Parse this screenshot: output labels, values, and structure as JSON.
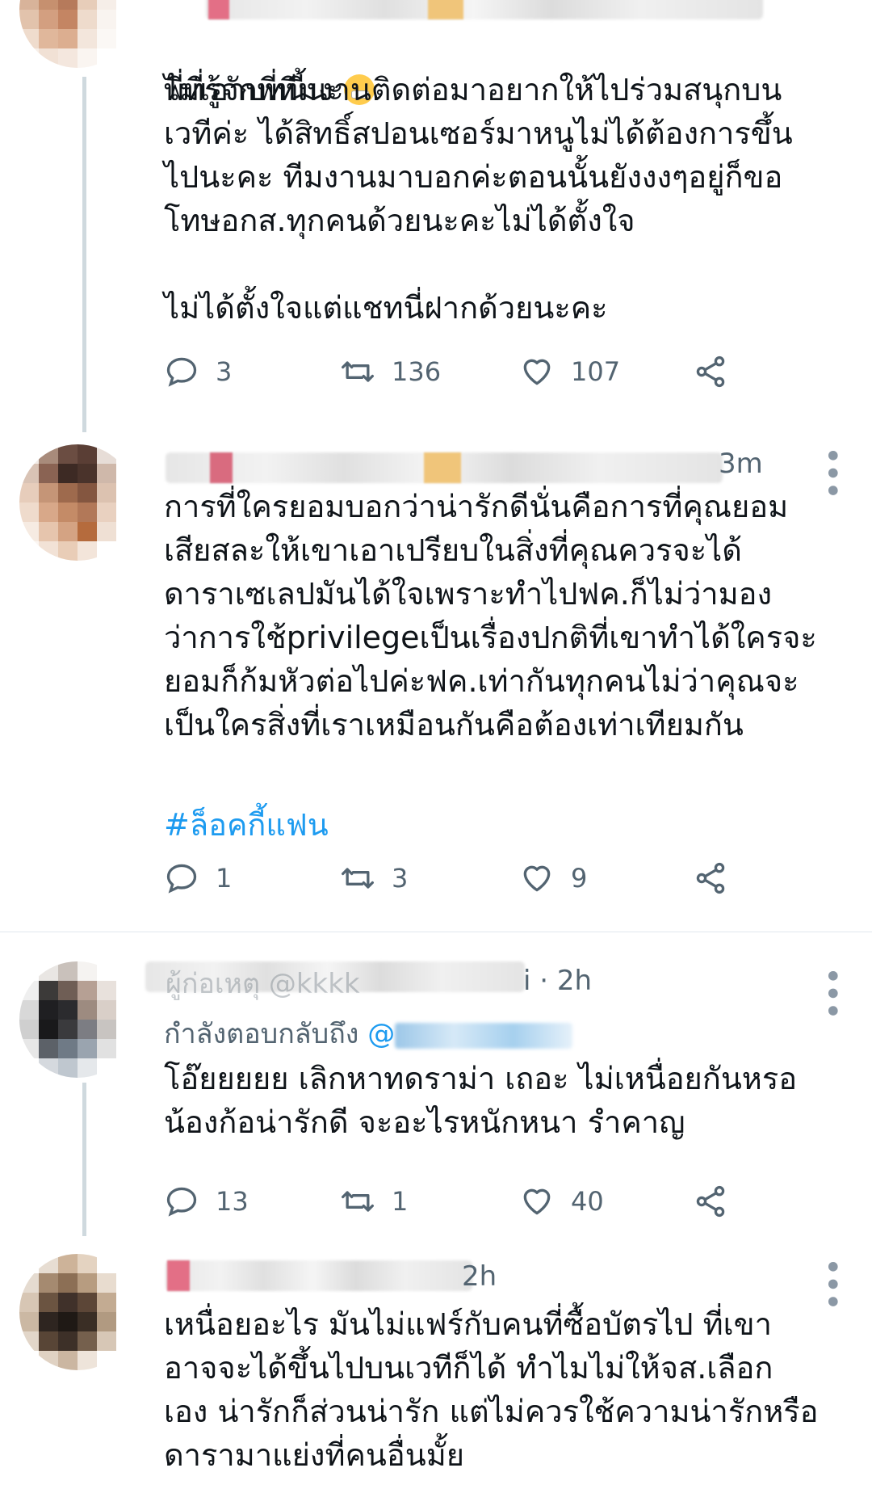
{
  "tweets": [
    {
      "text": "ไม่เอาบทนี้นะ",
      "text2": "พี่ที่รู้จักพี่ทีมงานติดต่อมาอยากให้ไปร่วมสนุกบน\nเวทีค่ะ ได้สิทธิ์สปอนเซอร์มาหนูไม่ได้ต้องการขึ้น\nไปนะคะ ทีมงานมาบอกค่ะตอนนั้นยังงงๆอยู่ก็ขอ\nโทษอกส.ทุกคนด้วยนะคะไม่ได้ตั้งใจ\n\nไม่ได้ตั้งใจแต่แชทนี่ฝากด้วยนะคะ",
      "emoji": "nauseated-face-emoji",
      "replies": "3",
      "retweets": "136",
      "likes": "107"
    },
    {
      "time": "3m",
      "text": "การที่ใครยอมบอกว่าน่ารักดีนั่นคือการที่คุณยอม\nเสียสละให้เขาเอาเปรียบในสิ่งที่คุณควรจะได้\nดาราเซเลปมันได้ใจเพราะทำไปฟค.ก็ไม่ว่ามอง\nว่าการใช้privilegeเป็นเรื่องปกติที่เขาทำได้ใครจะ\nยอมก็ก้มหัวต่อไปค่ะฟค.เท่ากันทุกคนไม่ว่าคุณจะ\nเป็นใครสิ่งที่เราเหมือนกันคือต้องเท่าเทียมกัน",
      "hashtag": "#ล็อคกี้แฟน",
      "replies": "1",
      "retweets": "3",
      "likes": "9"
    },
    {
      "name_partial": "ผู้ก่อเหตุ @kkkk",
      "handle_tail": "i · 2h",
      "replying_to": "กำลังตอบกลับถึง",
      "mention_prefix": "@",
      "mention_mid": "_",
      "text": "โอ๊ยยยยย เลิกหาทดราม่า เถอะ ไม่เหนื่อยกันหรอ\nน้องก้อน่ารักดี จะอะไรหนักหนา รำคาญ",
      "replies": "13",
      "retweets": "1",
      "likes": "40"
    },
    {
      "time": "2h",
      "text": "เหนื่อยอะไร มันไม่แฟร์กับคนที่ซื้อบัตรไป ที่เขา\nอาจจะได้ขึ้นไปบนเวทีก็ได้ ทำไมไม่ให้จส.เลือก\nเอง น่ารักก็ส่วนน่ารัก แต่ไม่ควรใช้ความน่ารักหรือ\nดารามาแย่งที่คนอื่นมั้ย"
    }
  ],
  "colors": {
    "text": "#0f1419",
    "muted": "#536471",
    "accent": "#1d9bf0",
    "divider": "#e1e8ed"
  },
  "icons": [
    "reply-icon",
    "retweet-icon",
    "like-icon",
    "share-icon",
    "more-icon"
  ]
}
